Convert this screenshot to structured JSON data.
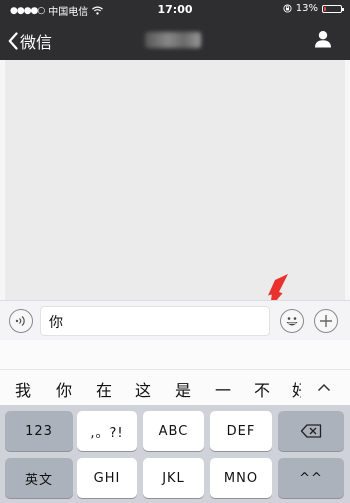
{
  "status_bar": {
    "signal": "●●●●○",
    "carrier": "中国电信",
    "time": "17:00",
    "battery_text": "13%",
    "battery_level": 0.13,
    "battery_color": "#e0463c"
  },
  "nav": {
    "back_label": "微信"
  },
  "input": {
    "text": "你"
  },
  "candidates": [
    "我",
    "你",
    "在",
    "这",
    "是",
    "一",
    "不",
    "好"
  ],
  "keyboard": {
    "rows": [
      [
        "123",
        ",。?!",
        "ABC",
        "DEF"
      ],
      [
        "英文",
        "GHI",
        "JKL",
        "MNO",
        "^^"
      ]
    ]
  },
  "colors": {
    "nav_background": "#2e2e31",
    "chat_background": "#ebebeb",
    "annotation_arrow": "#e8322d"
  },
  "icons": {
    "back": "chevron-left-icon",
    "profile": "person-icon",
    "voice": "voice-icon",
    "emoji": "smiley-icon",
    "more": "plus-icon",
    "collapse": "chevron-up-icon",
    "delete": "backspace-icon",
    "wifi": "wifi-icon",
    "lock": "rotation-lock-icon"
  }
}
